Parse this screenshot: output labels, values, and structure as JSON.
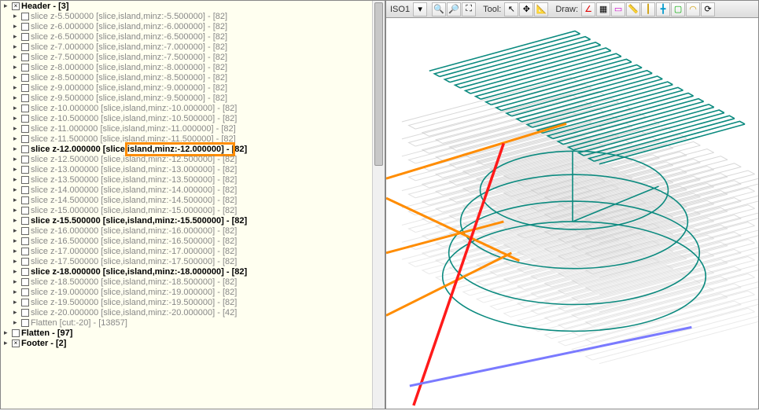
{
  "tree": {
    "header": {
      "label": "Header - [3]",
      "bold": true,
      "checked": true
    },
    "slices": [
      {
        "z": "5.500000",
        "min": "-5.500000",
        "cnt": "82"
      },
      {
        "z": "6.000000",
        "min": "-6.000000",
        "cnt": "82"
      },
      {
        "z": "6.500000",
        "min": "-6.500000",
        "cnt": "82"
      },
      {
        "z": "7.000000",
        "min": "-7.000000",
        "cnt": "82"
      },
      {
        "z": "7.500000",
        "min": "-7.500000",
        "cnt": "82"
      },
      {
        "z": "8.000000",
        "min": "-8.000000",
        "cnt": "82"
      },
      {
        "z": "8.500000",
        "min": "-8.500000",
        "cnt": "82"
      },
      {
        "z": "9.000000",
        "min": "-9.000000",
        "cnt": "82"
      },
      {
        "z": "9.500000",
        "min": "-9.500000",
        "cnt": "82"
      },
      {
        "z": "10.000000",
        "min": "-10.000000",
        "cnt": "82"
      },
      {
        "z": "10.500000",
        "min": "-10.500000",
        "cnt": "82"
      },
      {
        "z": "11.000000",
        "min": "-11.000000",
        "cnt": "82"
      },
      {
        "z": "11.500000",
        "min": "-11.500000",
        "cnt": "82"
      },
      {
        "z": "12.000000",
        "min": "-12.000000",
        "cnt": "82",
        "bold": true,
        "orange_col": true
      },
      {
        "z": "12.500000",
        "min": "-12.500000",
        "cnt": "82"
      },
      {
        "z": "13.000000",
        "min": "-13.000000",
        "cnt": "82"
      },
      {
        "z": "13.500000",
        "min": "-13.500000",
        "cnt": "82"
      },
      {
        "z": "14.000000",
        "min": "-14.000000",
        "cnt": "82"
      },
      {
        "z": "14.500000",
        "min": "-14.500000",
        "cnt": "82"
      },
      {
        "z": "15.000000",
        "min": "-15.000000",
        "cnt": "82"
      },
      {
        "z": "15.500000",
        "min": "-15.500000",
        "cnt": "82",
        "bold": true
      },
      {
        "z": "16.000000",
        "min": "-16.000000",
        "cnt": "82"
      },
      {
        "z": "16.500000",
        "min": "-16.500000",
        "cnt": "82"
      },
      {
        "z": "17.000000",
        "min": "-17.000000",
        "cnt": "82"
      },
      {
        "z": "17.500000",
        "min": "-17.500000",
        "cnt": "82"
      },
      {
        "z": "18.000000",
        "min": "-18.000000",
        "cnt": "82",
        "bold": true
      },
      {
        "z": "18.500000",
        "min": "-18.500000",
        "cnt": "82"
      },
      {
        "z": "19.000000",
        "min": "-19.000000",
        "cnt": "82"
      },
      {
        "z": "19.500000",
        "min": "-19.500000",
        "cnt": "82"
      },
      {
        "z": "20.000000",
        "min": "-20.000000",
        "cnt": "42"
      }
    ],
    "flatten_cut": {
      "label": "Flatten [cut:-20] - [13857]"
    },
    "flatten": {
      "label": "Flatten - [97]",
      "bold": true
    },
    "footer": {
      "label": "Footer - [2]",
      "bold": true,
      "checked": true
    }
  },
  "toolbar": {
    "iso_label": "ISO1",
    "tool_label": "Tool:",
    "draw_label": "Draw:"
  },
  "colors": {
    "teal": "#0b8a7f",
    "grey": "#c8c8c8",
    "orange": "#ff8c00",
    "red": "#ff1a1a",
    "blue": "#7a7aff"
  }
}
